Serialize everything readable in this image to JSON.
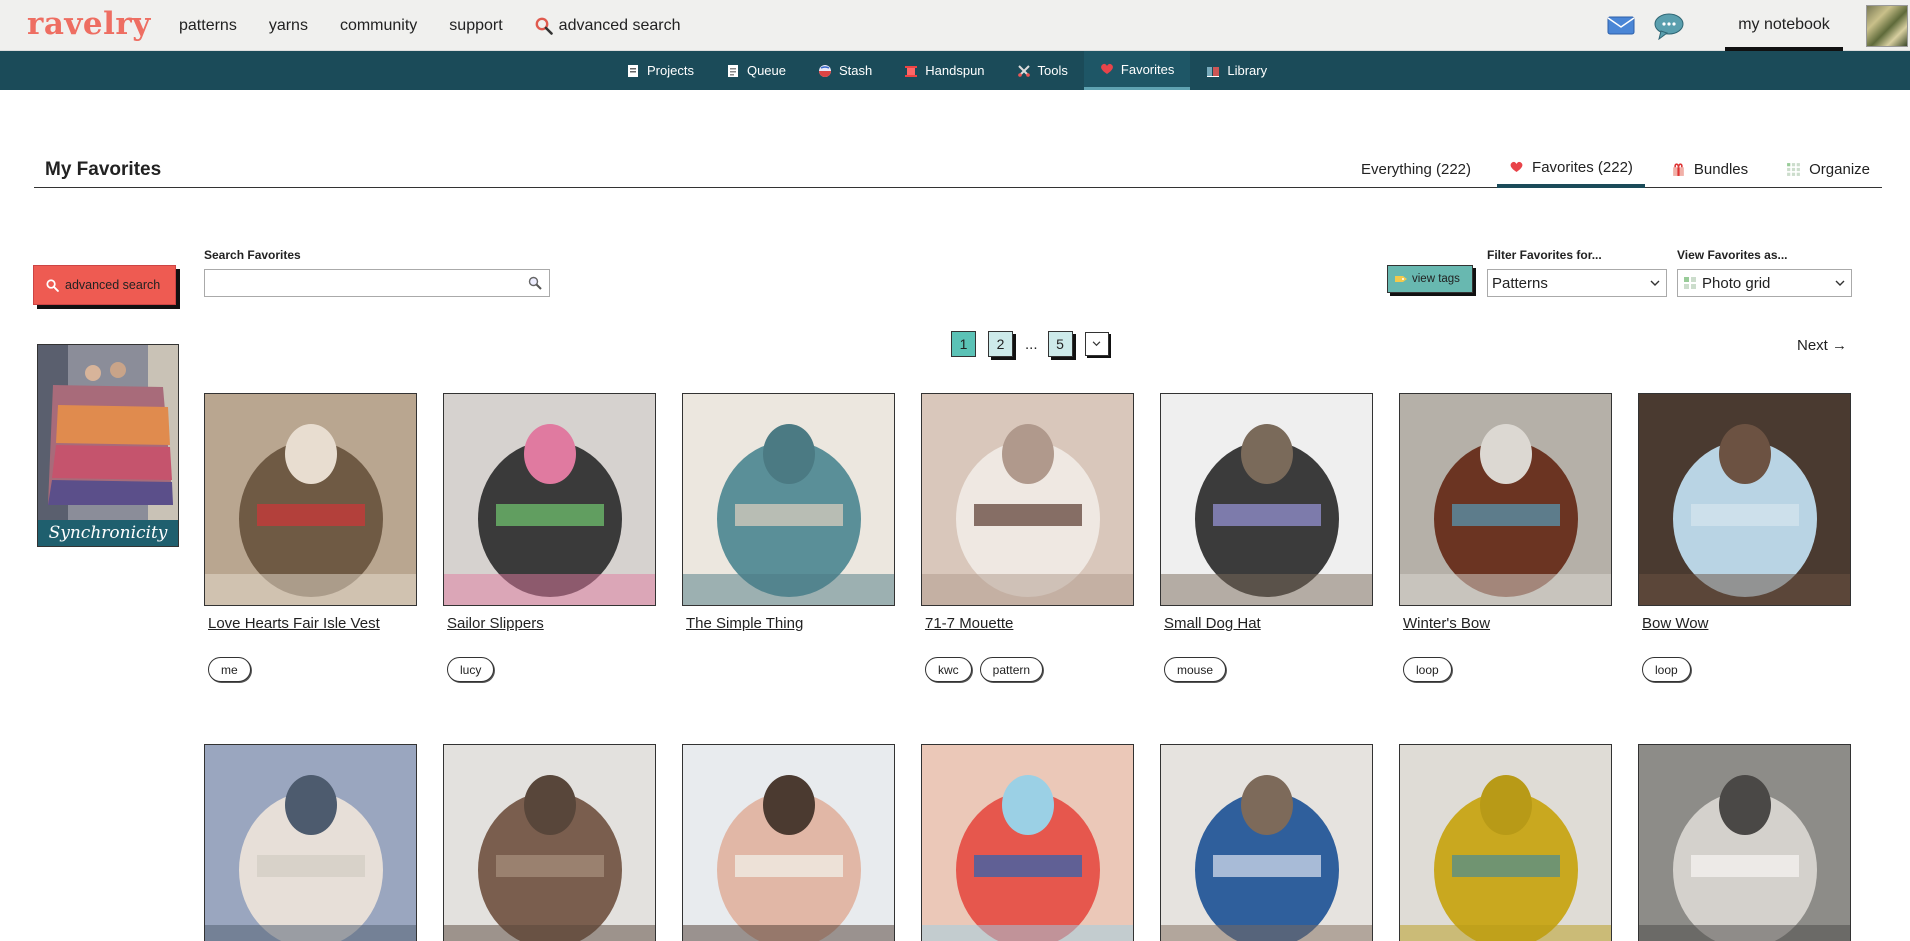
{
  "topnav": {
    "logo": "ravelry",
    "links": [
      "patterns",
      "yarns",
      "community",
      "support"
    ],
    "search_label": "advanced search",
    "notebook_label": "my notebook"
  },
  "notebook_bar": {
    "items": [
      {
        "label": "Projects",
        "icon": "projects-icon"
      },
      {
        "label": "Queue",
        "icon": "queue-icon"
      },
      {
        "label": "Stash",
        "icon": "stash-icon"
      },
      {
        "label": "Handspun",
        "icon": "handspun-icon"
      },
      {
        "label": "Tools",
        "icon": "tools-icon"
      },
      {
        "label": "Favorites",
        "icon": "heart-icon",
        "active": true
      },
      {
        "label": "Library",
        "icon": "library-icon"
      }
    ]
  },
  "page": {
    "title": "My Favorites",
    "tabs": [
      {
        "label": "Everything (222)"
      },
      {
        "label": "Favorites (222)",
        "active": true
      },
      {
        "label": "Bundles"
      },
      {
        "label": "Organize"
      }
    ]
  },
  "controls": {
    "advanced_search_label": "advanced search",
    "search_label": "Search Favorites",
    "search_value": "",
    "view_tags_label": "view tags",
    "filter_label": "Filter Favorites for...",
    "filter_value": "Patterns",
    "view_as_label": "View Favorites as...",
    "view_as_value": "Photo grid"
  },
  "pagination": {
    "pages": [
      "1",
      "2",
      "5"
    ],
    "current": "1",
    "ellipsis": "...",
    "next_label": "Next →"
  },
  "bundle": {
    "label": "Synchronicity"
  },
  "items": [
    {
      "title": "Love Hearts Fair Isle Vest",
      "tags": [
        "me"
      ]
    },
    {
      "title": "Sailor Slippers",
      "tags": [
        "lucy"
      ]
    },
    {
      "title": "The Simple Thing",
      "tags": []
    },
    {
      "title": "71-7 Mouette",
      "tags": [
        "kwc",
        "pattern"
      ]
    },
    {
      "title": "Small Dog Hat",
      "tags": [
        "mouse"
      ]
    },
    {
      "title": "Winter's Bow",
      "tags": [
        "loop"
      ]
    },
    {
      "title": "Bow Wow",
      "tags": [
        "loop"
      ]
    },
    {
      "title": "",
      "tags": []
    },
    {
      "title": "",
      "tags": []
    },
    {
      "title": "",
      "tags": []
    },
    {
      "title": "",
      "tags": []
    },
    {
      "title": "",
      "tags": []
    },
    {
      "title": "",
      "tags": []
    },
    {
      "title": "",
      "tags": []
    }
  ],
  "colors": {
    "brand": "#ee6e62",
    "notebook_bar": "#1b4b59",
    "accent_teal": "#5bc2b6"
  }
}
